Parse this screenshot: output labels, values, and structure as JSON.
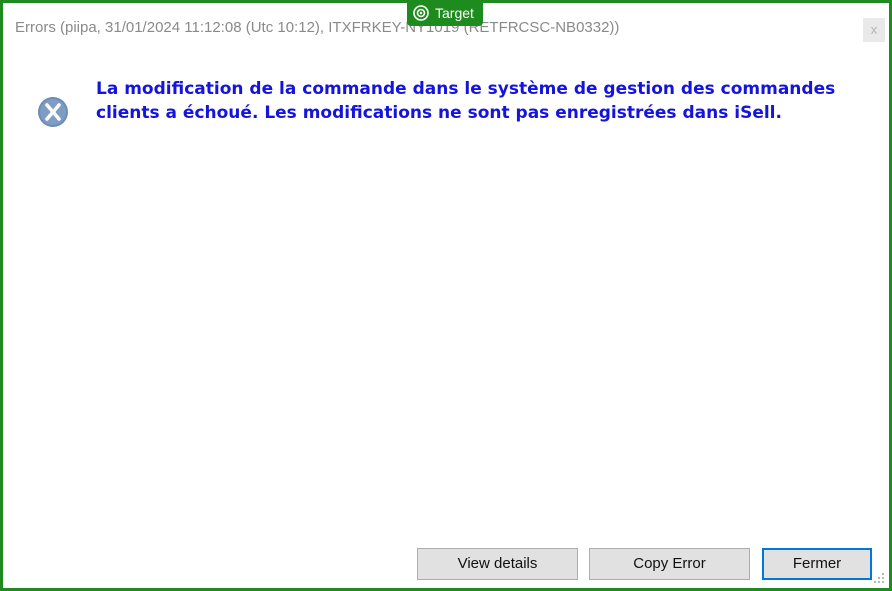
{
  "window": {
    "title": "Errors (piipa, 31/01/2024 11:12:08 (Utc 10:12), ITXFRKEY-NY1019 (RETFRCSC-NB0332))",
    "close_label": "x"
  },
  "target_badge": {
    "label": "Target",
    "icon": "target-icon"
  },
  "dialog": {
    "icon": "error-x-icon",
    "message": "La modification de la commande dans le système de gestion des commandes clients a échoué. Les modifications ne sont pas enregistrées dans iSell."
  },
  "buttons": {
    "view_details": "View details",
    "copy_error": "Copy Error",
    "close": "Fermer"
  },
  "colors": {
    "frame": "#1f8a1f",
    "message_text": "#1414dc",
    "default_button_border": "#0078d7"
  }
}
